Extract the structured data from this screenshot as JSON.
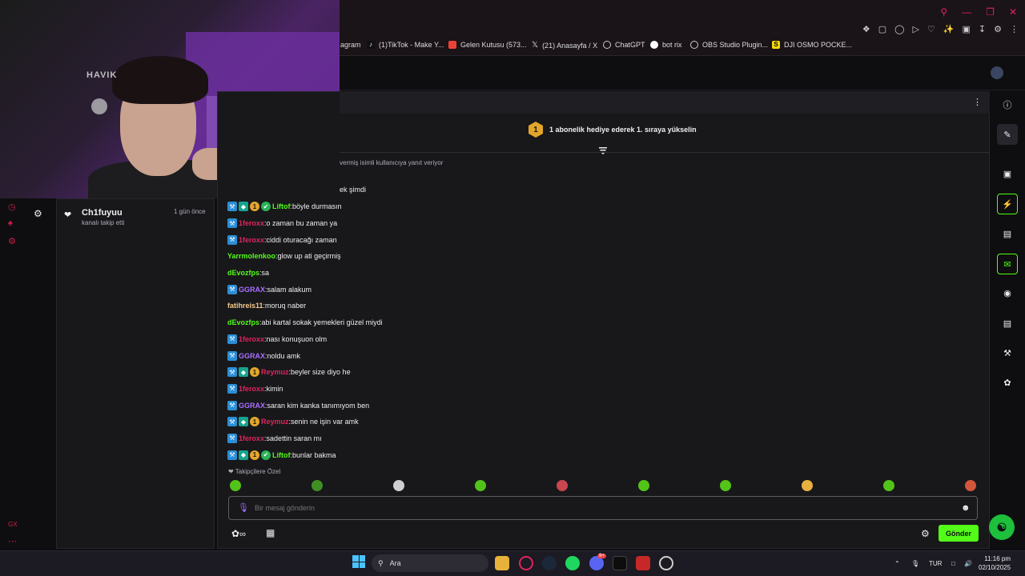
{
  "browser": {
    "bookmarks": [
      {
        "label": "agram",
        "icon": "instagram-icon"
      },
      {
        "label": "(1)TikTok - Make Y...",
        "icon": "tiktok-icon"
      },
      {
        "label": "Gelen Kutusu (573...",
        "icon": "gmail-icon"
      },
      {
        "label": "(21) Anasayfa / X",
        "icon": "x-icon"
      },
      {
        "label": "ChatGPT",
        "icon": "chatgpt-icon"
      },
      {
        "label": "bot rix",
        "icon": "botrix-icon"
      },
      {
        "label": "OBS Studio Plugin...",
        "icon": "obs-icon"
      },
      {
        "label": "DJI OSMO POCKE...",
        "icon": "dji-icon"
      }
    ]
  },
  "webcam": {
    "logo_text": "HAVIK"
  },
  "activity": {
    "items": [
      {
        "name": "Ch1fuyuu",
        "action": "kanalı takip etti",
        "time": "1 gün önce",
        "icon": "heart-icon"
      }
    ]
  },
  "chat": {
    "subscription_banner": {
      "rank": "1",
      "text": "1 abonelik hediye ederek 1. sıraya yükselin"
    },
    "reply_hint": "vermiş isimli kullanıcıya yanıt veriyor",
    "partial_message": "ek şimdi",
    "messages": [
      {
        "user": "Liftof",
        "text": "böyle durmasın",
        "color": "#53fc18",
        "badges": [
          "mod",
          "vip",
          "sub",
          "verified"
        ]
      },
      {
        "user": "1feroxx",
        "text": "o zaman bu zaman ya",
        "color": "#e0245e",
        "badges": [
          "mod"
        ]
      },
      {
        "user": "1feroxx",
        "text": "ciddi oturacağı zaman",
        "color": "#e0245e",
        "badges": [
          "mod"
        ]
      },
      {
        "user": "Yarrmolenkoo",
        "text": "glow up ati geçirmiş",
        "color": "#53fc18",
        "badges": []
      },
      {
        "user": "dEvozfps",
        "text": "sa",
        "color": "#53fc18",
        "badges": []
      },
      {
        "user": "GGRAX",
        "text": "salam alakum",
        "color": "#a970ff",
        "badges": [
          "mod"
        ]
      },
      {
        "user": "fatihreis11",
        "text": "moruq naber",
        "color": "#f3c98b",
        "badges": []
      },
      {
        "user": "dEvozfps",
        "text": "abi kartal sokak yemekleri güzel miydi",
        "color": "#53fc18",
        "badges": []
      },
      {
        "user": "1feroxx",
        "text": "nası konuşuon olm",
        "color": "#e0245e",
        "badges": [
          "mod"
        ]
      },
      {
        "user": "GGRAX",
        "text": "noldu amk",
        "color": "#a970ff",
        "badges": [
          "mod"
        ]
      },
      {
        "user": "Reymuz",
        "text": "beyler size diyo he",
        "color": "#e0245e",
        "badges": [
          "mod",
          "vip",
          "sub"
        ]
      },
      {
        "user": "1feroxx",
        "text": "kimin",
        "color": "#e0245e",
        "badges": [
          "mod"
        ]
      },
      {
        "user": "GGRAX",
        "text": "saran kim kanka tanımıyom ben",
        "color": "#a970ff",
        "badges": [
          "mod"
        ]
      },
      {
        "user": "Reymuz",
        "text": "senin ne işin var amk",
        "color": "#e0245e",
        "badges": [
          "mod",
          "vip",
          "sub"
        ]
      },
      {
        "user": "1feroxx",
        "text": "sadettin saran mı",
        "color": "#e0245e",
        "badges": [
          "mod"
        ]
      },
      {
        "user": "Liftof",
        "text": "bunlar bakma",
        "color": "#53fc18",
        "badges": [
          "mod",
          "vip",
          "sub",
          "verified"
        ]
      }
    ],
    "follow_only_label": "Takipçilere Özel",
    "input_placeholder": "Bir mesaj gönderin",
    "points_label": "∞",
    "send_label": "Gönder"
  },
  "right_rail": {
    "icons": [
      "info-icon",
      "pencil-icon",
      "focus-icon",
      "lightning-icon",
      "clipboard-icon",
      "chat-icon",
      "broadcast-icon",
      "layout-icon",
      "wrench-icon",
      "nodes-icon"
    ]
  },
  "left_rail": {
    "label_bottom": "GX"
  },
  "taskbar": {
    "search_label": "Ara",
    "discord_badge": "9+",
    "language": "TUR",
    "time": "11:16 pm",
    "date": "02/10/2025"
  },
  "colors": {
    "accent_green": "#53fc18",
    "panel_bg": "#18181b",
    "page_bg": "#0e0e10"
  }
}
